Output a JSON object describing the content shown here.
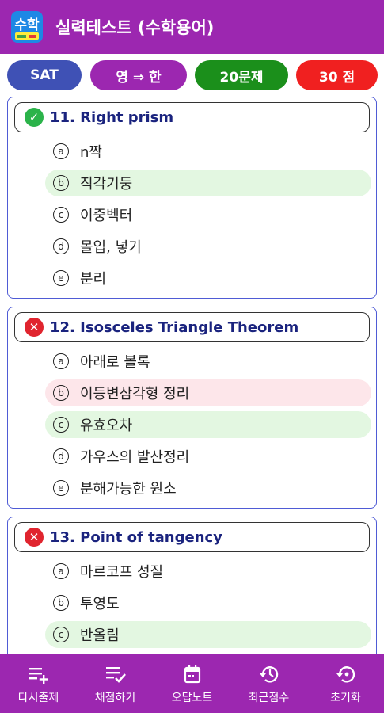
{
  "appbar": {
    "icon_text": "수학",
    "title": "실력테스트 (수학용어)"
  },
  "pills": [
    {
      "label": "SAT",
      "color": "#3f51b5"
    },
    {
      "label": "영 ⇒ 한",
      "color": "#9c27b0"
    },
    {
      "label": "20문제",
      "color": "#1b8f1b"
    },
    {
      "label": "30 점",
      "color": "#f02020"
    }
  ],
  "questions": [
    {
      "title": "11. Right prism",
      "status": "correct",
      "options": [
        {
          "mark": "a",
          "text": "n짝",
          "state": ""
        },
        {
          "mark": "b",
          "text": "직각기둥",
          "state": "correct"
        },
        {
          "mark": "c",
          "text": "이중벡터",
          "state": ""
        },
        {
          "mark": "d",
          "text": "몰입, 넣기",
          "state": ""
        },
        {
          "mark": "e",
          "text": "분리",
          "state": ""
        }
      ]
    },
    {
      "title": "12. Isosceles Triangle Theorem",
      "status": "wrong",
      "options": [
        {
          "mark": "a",
          "text": "아래로 볼록",
          "state": ""
        },
        {
          "mark": "b",
          "text": "이등변삼각형 정리",
          "state": "wrong"
        },
        {
          "mark": "c",
          "text": "유효오차",
          "state": "correct"
        },
        {
          "mark": "d",
          "text": "가우스의 발산정리",
          "state": ""
        },
        {
          "mark": "e",
          "text": "분해가능한 원소",
          "state": ""
        }
      ]
    },
    {
      "title": "13. Point of tangency",
      "status": "wrong",
      "options": [
        {
          "mark": "a",
          "text": "마르코프 성질",
          "state": ""
        },
        {
          "mark": "b",
          "text": "투영도",
          "state": ""
        },
        {
          "mark": "c",
          "text": "반올림",
          "state": "correct"
        }
      ]
    }
  ],
  "bottom_nav": [
    {
      "label": "다시출제",
      "icon": "playlist-add-icon"
    },
    {
      "label": "채점하기",
      "icon": "playlist-check-icon"
    },
    {
      "label": "오답노트",
      "icon": "calendar-icon"
    },
    {
      "label": "최근점수",
      "icon": "history-icon"
    },
    {
      "label": "초기화",
      "icon": "restore-icon"
    }
  ]
}
